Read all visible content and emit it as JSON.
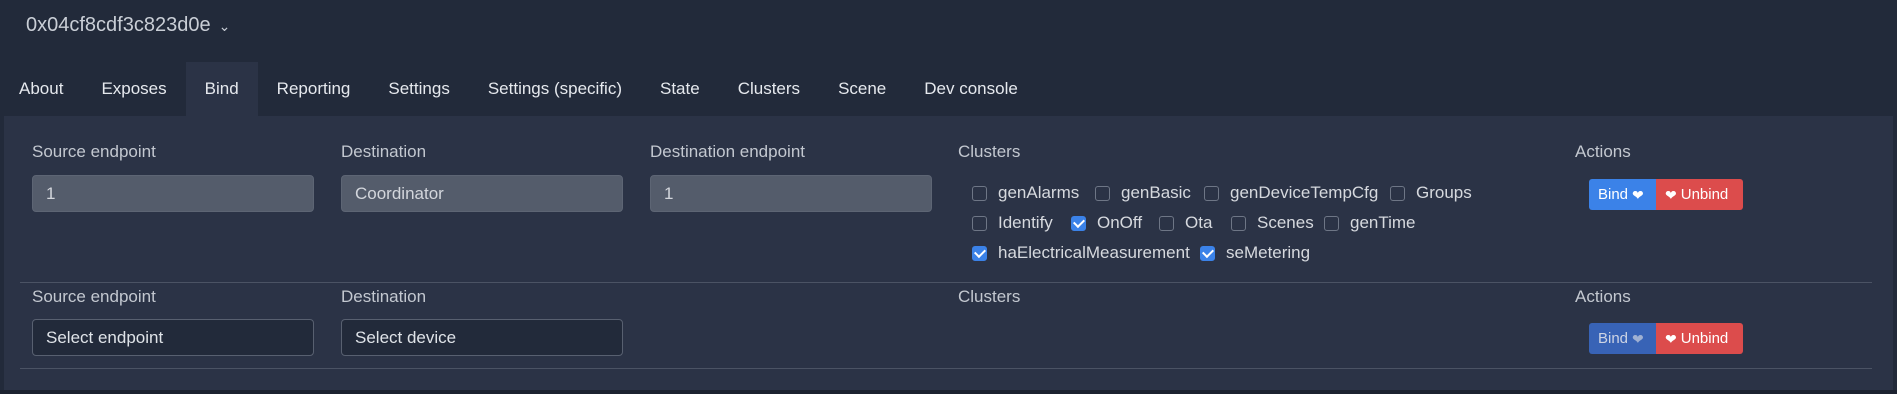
{
  "device": {
    "title": "0x04cf8cdf3c823d0e",
    "chevron_icon": "chevron-down-icon"
  },
  "tabs": [
    {
      "label": "About"
    },
    {
      "label": "Exposes"
    },
    {
      "label": "Bind",
      "active": true
    },
    {
      "label": "Reporting"
    },
    {
      "label": "Settings"
    },
    {
      "label": "Settings (specific)"
    },
    {
      "label": "State"
    },
    {
      "label": "Clusters"
    },
    {
      "label": "Scene"
    },
    {
      "label": "Dev console"
    }
  ],
  "row1": {
    "source_label": "Source endpoint",
    "source_value": "1",
    "destination_label": "Destination",
    "destination_value": "Coordinator",
    "dest_endpoint_label": "Destination endpoint",
    "dest_endpoint_value": "1",
    "clusters_label": "Clusters",
    "clusters": [
      {
        "label": "genAlarms",
        "checked": false
      },
      {
        "label": "genBasic",
        "checked": false
      },
      {
        "label": "genDeviceTempCfg",
        "checked": false
      },
      {
        "label": "Groups",
        "checked": false
      },
      {
        "label": "Identify",
        "checked": false
      },
      {
        "label": "OnOff",
        "checked": true
      },
      {
        "label": "Ota",
        "checked": false
      },
      {
        "label": "Scenes",
        "checked": false
      },
      {
        "label": "genTime",
        "checked": false
      },
      {
        "label": "haElectricalMeasurement",
        "checked": true
      },
      {
        "label": "seMetering",
        "checked": true
      }
    ],
    "actions_label": "Actions",
    "bind_label": "Bind",
    "unbind_label": "Unbind"
  },
  "row2": {
    "source_label": "Source endpoint",
    "source_placeholder": "Select endpoint",
    "destination_label": "Destination",
    "destination_placeholder": "Select device",
    "clusters_label": "Clusters",
    "actions_label": "Actions",
    "bind_label": "Bind",
    "unbind_label": "Unbind"
  },
  "colors": {
    "accent": "#3b82e8",
    "danger": "#dc4c4c",
    "background": "#222a3a",
    "panel": "#2b3346"
  }
}
